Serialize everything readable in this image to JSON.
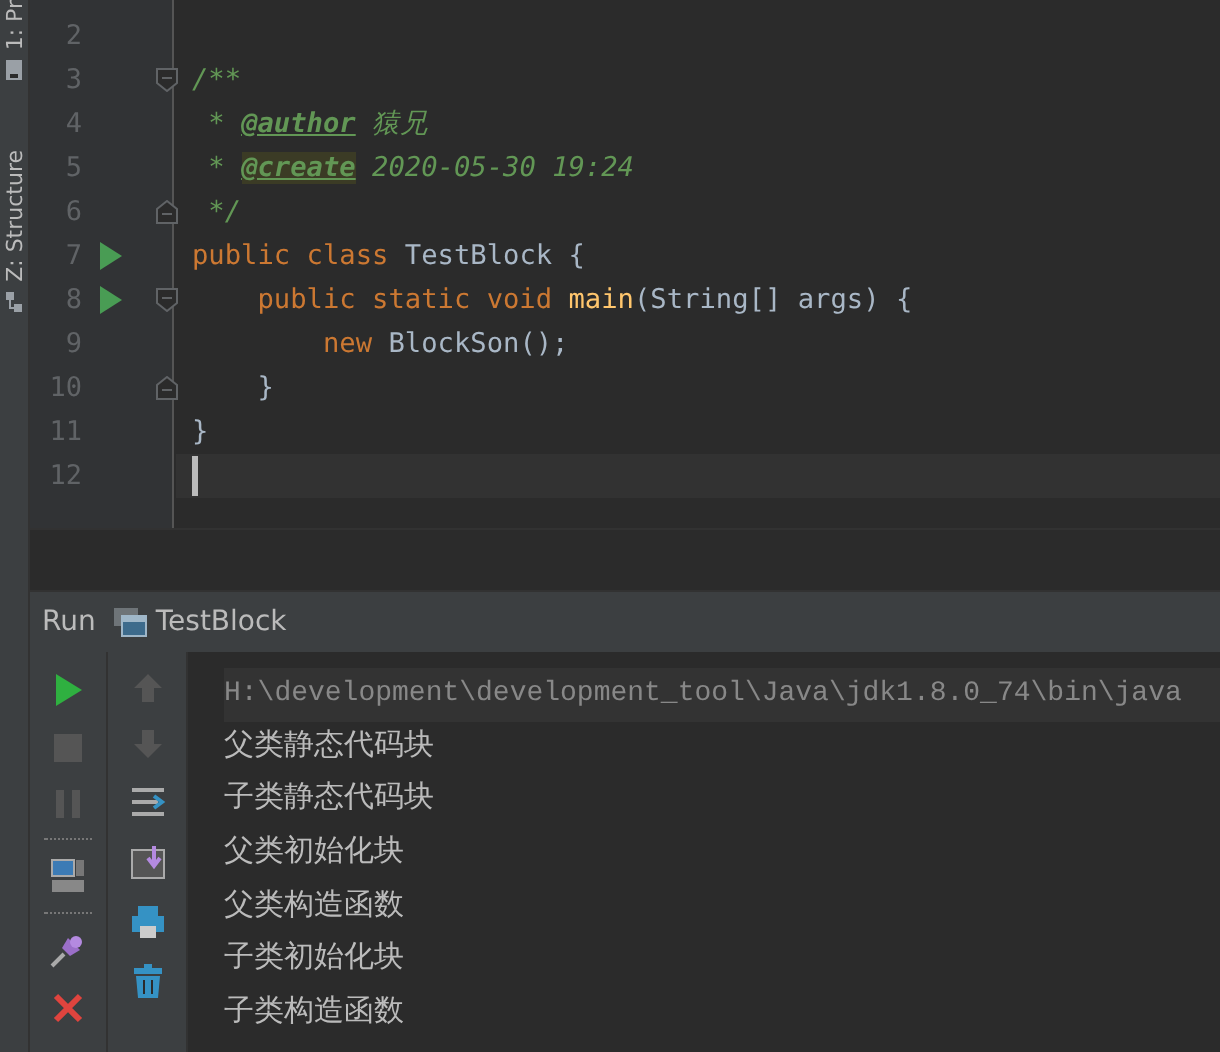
{
  "side_tabs": [
    {
      "label": "1: Pr"
    },
    {
      "label": "Z: Structure"
    }
  ],
  "editor": {
    "lines": [
      {
        "number": "2"
      },
      {
        "number": "3",
        "fold_start": true,
        "tokens": [
          {
            "kind": "comment",
            "text": "/**"
          }
        ]
      },
      {
        "number": "4",
        "tokens": [
          {
            "kind": "comment",
            "text": " * "
          },
          {
            "kind": "tag",
            "text": "@author"
          },
          {
            "kind": "comment",
            "text": " 猿兄"
          }
        ]
      },
      {
        "number": "5",
        "tokens": [
          {
            "kind": "comment",
            "text": " * "
          },
          {
            "kind": "tag-highlight",
            "text": "@create"
          },
          {
            "kind": "comment",
            "text": " 2020-05-30 19:24"
          }
        ]
      },
      {
        "number": "6",
        "fold_end": true,
        "tokens": [
          {
            "kind": "comment",
            "text": " */"
          }
        ]
      },
      {
        "number": "7",
        "runnable": true,
        "tokens": [
          {
            "kind": "keyword",
            "text": "public class "
          },
          {
            "kind": "plain",
            "text": "TestBlock {"
          }
        ]
      },
      {
        "number": "8",
        "runnable": true,
        "fold_start": true,
        "tokens": [
          {
            "kind": "keyword",
            "text": "    public static void "
          },
          {
            "kind": "method",
            "text": "main"
          },
          {
            "kind": "plain",
            "text": "(String[] args) {"
          }
        ]
      },
      {
        "number": "9",
        "tokens": [
          {
            "kind": "keyword",
            "text": "        new "
          },
          {
            "kind": "plain",
            "text": "BlockSon();"
          }
        ]
      },
      {
        "number": "10",
        "fold_end": true,
        "tokens": [
          {
            "kind": "plain",
            "text": "    }"
          }
        ]
      },
      {
        "number": "11",
        "tokens": [
          {
            "kind": "plain",
            "text": "}"
          }
        ]
      },
      {
        "number": "12",
        "current": true
      }
    ]
  },
  "run_panel": {
    "label": "Run",
    "config": "TestBlock",
    "left_tools": [
      {
        "kind": "run"
      },
      {
        "kind": "stop"
      },
      {
        "kind": "pause"
      },
      {
        "kind": "sep"
      },
      {
        "kind": "layout"
      },
      {
        "kind": "sep"
      },
      {
        "kind": "pin"
      },
      {
        "kind": "close"
      }
    ],
    "right_tools": [
      {
        "kind": "up"
      },
      {
        "kind": "down"
      },
      {
        "kind": "wrap"
      },
      {
        "kind": "scroll-end"
      },
      {
        "kind": "print"
      },
      {
        "kind": "trash"
      }
    ],
    "console": [
      {
        "kind": "command",
        "text": "H:\\development\\development_tool\\Java\\jdk1.8.0_74\\bin\\java"
      },
      {
        "kind": "output",
        "text": "父类静态代码块"
      },
      {
        "kind": "output",
        "text": "子类静态代码块"
      },
      {
        "kind": "output",
        "text": "父类初始化块"
      },
      {
        "kind": "output",
        "text": "父类构造函数"
      },
      {
        "kind": "output",
        "text": "子类初始化块"
      },
      {
        "kind": "output",
        "text": "子类构造函数"
      }
    ]
  }
}
